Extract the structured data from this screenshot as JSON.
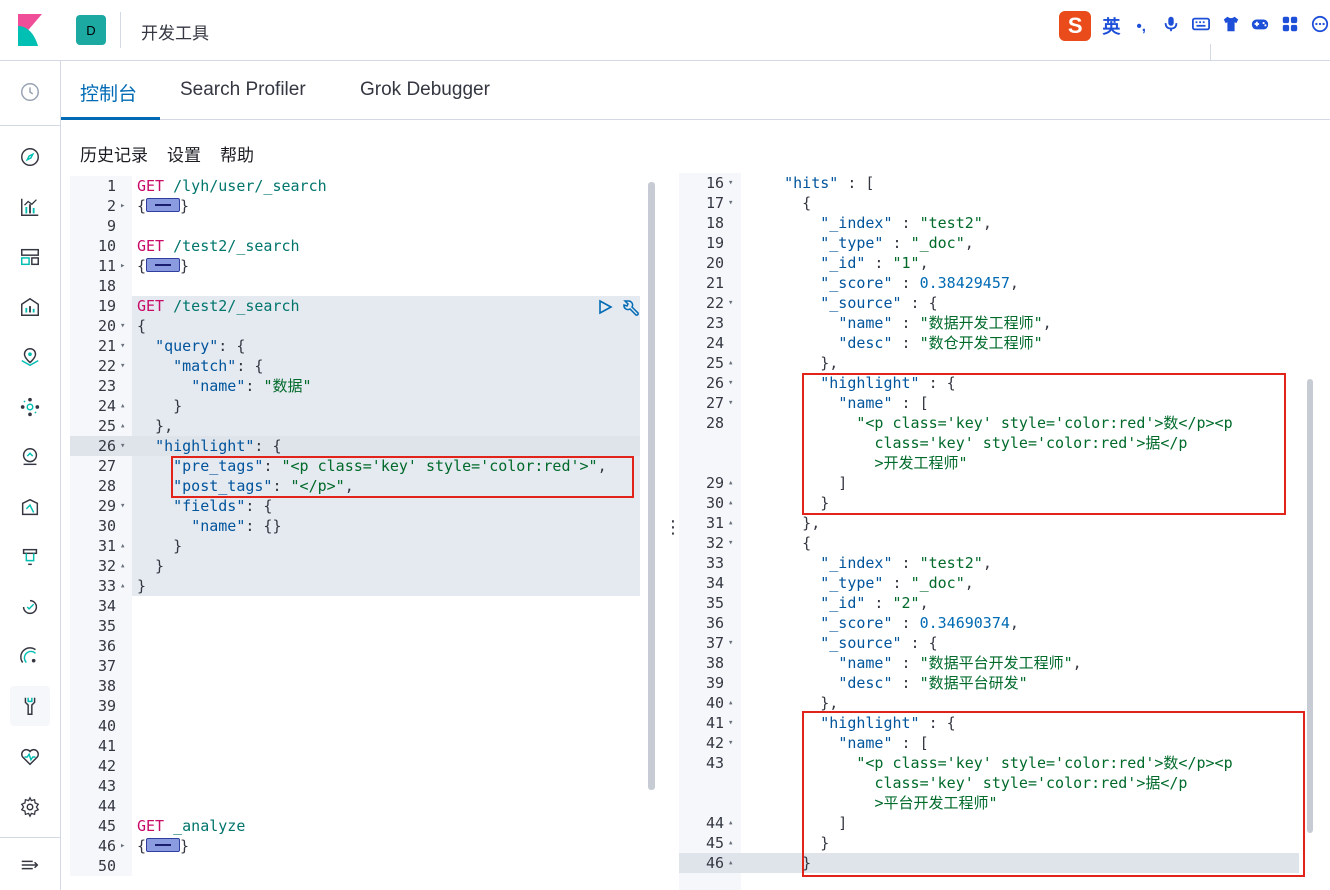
{
  "header": {
    "space_initial": "D",
    "app_title": "开发工具",
    "ime": {
      "logo": "S",
      "mode": "英",
      "punct": "•,",
      "icons": [
        "microphone-icon",
        "keyboard-icon",
        "shirt-icon",
        "gamepad-icon",
        "apps-grid-icon",
        "more-icon"
      ]
    }
  },
  "nav": {
    "icons": [
      "clock-icon",
      "compass-icon",
      "chart-icon",
      "dashboard-icon",
      "canvas-icon",
      "map-pin-icon",
      "ml-icon",
      "graph-icon",
      "apm-icon",
      "logs-icon",
      "uptime-icon",
      "siem-icon",
      "dev-tools-icon",
      "monitoring-icon",
      "gear-icon",
      "collapse-icon"
    ],
    "active": "dev-tools-icon"
  },
  "tabs": [
    {
      "label": "控制台",
      "active": true
    },
    {
      "label": "Search Profiler",
      "active": false
    },
    {
      "label": "Grok Debugger",
      "active": false
    }
  ],
  "submenu": [
    "历史记录",
    "设置",
    "帮助"
  ],
  "colors": {
    "accent": "#006bb4",
    "method": "#c80a68",
    "highlight_box": "#e2231a"
  },
  "request_editor": {
    "lines": [
      {
        "n": "1",
        "fold": "",
        "html": "<span class='k-m'>GET</span> <span class='k-p'>/lyh/user/_search</span>"
      },
      {
        "n": "2",
        "fold": "▸",
        "html": "{<span class='fold-chip'></span>}"
      },
      {
        "n": "9",
        "fold": "",
        "html": ""
      },
      {
        "n": "10",
        "fold": "",
        "html": "<span class='k-m'>GET</span> <span class='k-p'>/test2/_search</span>"
      },
      {
        "n": "11",
        "fold": "▸",
        "html": "{<span class='fold-chip'></span>}"
      },
      {
        "n": "18",
        "fold": "",
        "html": ""
      },
      {
        "n": "19",
        "fold": "",
        "html": "<span class='k-m'>GET</span> <span class='k-p'>/test2/_search</span>"
      },
      {
        "n": "20",
        "fold": "▾",
        "html": "{"
      },
      {
        "n": "21",
        "fold": "▾",
        "html": "  <span class='k-n'>\"query\"</span>: {"
      },
      {
        "n": "22",
        "fold": "▾",
        "html": "    <span class='k-n'>\"match\"</span>: {"
      },
      {
        "n": "23",
        "fold": "",
        "html": "      <span class='k-n'>\"name\"</span>: <span class='k-str'>\"数据\"</span>"
      },
      {
        "n": "24",
        "fold": "▴",
        "html": "    }"
      },
      {
        "n": "25",
        "fold": "▴",
        "html": "  },"
      },
      {
        "n": "26",
        "fold": "▾",
        "html": "  <span class='k-n'>\"highlight\"</span>: {"
      },
      {
        "n": "27",
        "fold": "",
        "html": "    <span class='k-n'>\"pre_tags\"</span>: <span class='k-str'>\"&lt;p class='key' style='color:red'&gt;\"</span>,"
      },
      {
        "n": "28",
        "fold": "",
        "html": "    <span class='k-n'>\"post_tags\"</span>: <span class='k-str'>\"&lt;/p&gt;\"</span>,"
      },
      {
        "n": "29",
        "fold": "▾",
        "html": "    <span class='k-n'>\"fields\"</span>: {"
      },
      {
        "n": "30",
        "fold": "",
        "html": "      <span class='k-n'>\"name\"</span>: {}"
      },
      {
        "n": "31",
        "fold": "▴",
        "html": "    }"
      },
      {
        "n": "32",
        "fold": "▴",
        "html": "  }"
      },
      {
        "n": "33",
        "fold": "▴",
        "html": "}"
      },
      {
        "n": "34",
        "fold": "",
        "html": ""
      },
      {
        "n": "35",
        "fold": "",
        "html": ""
      },
      {
        "n": "36",
        "fold": "",
        "html": ""
      },
      {
        "n": "37",
        "fold": "",
        "html": ""
      },
      {
        "n": "38",
        "fold": "",
        "html": ""
      },
      {
        "n": "39",
        "fold": "",
        "html": ""
      },
      {
        "n": "40",
        "fold": "",
        "html": ""
      },
      {
        "n": "41",
        "fold": "",
        "html": ""
      },
      {
        "n": "42",
        "fold": "",
        "html": ""
      },
      {
        "n": "43",
        "fold": "",
        "html": ""
      },
      {
        "n": "44",
        "fold": "",
        "html": ""
      },
      {
        "n": "45",
        "fold": "",
        "html": "<span class='k-m'>GET</span> <span class='k-p'>_analyze</span>"
      },
      {
        "n": "46",
        "fold": "▸",
        "html": "{<span class='fold-chip'></span>}"
      },
      {
        "n": "50",
        "fold": "",
        "html": ""
      }
    ]
  },
  "response_editor": {
    "lines": [
      {
        "n": "16",
        "fold": "▾",
        "html": "    <span class='k-n'>\"hits\"</span> : ["
      },
      {
        "n": "17",
        "fold": "▾",
        "html": "      {"
      },
      {
        "n": "18",
        "fold": "",
        "html": "        <span class='k-n'>\"_index\"</span> : <span class='k-str'>\"test2\"</span>,"
      },
      {
        "n": "19",
        "fold": "",
        "html": "        <span class='k-n'>\"_type\"</span> : <span class='k-str'>\"_doc\"</span>,"
      },
      {
        "n": "20",
        "fold": "",
        "html": "        <span class='k-n'>\"_id\"</span> : <span class='k-str'>\"1\"</span>,"
      },
      {
        "n": "21",
        "fold": "",
        "html": "        <span class='k-n'>\"_score\"</span> : <span class='k-num'>0.38429457</span>,"
      },
      {
        "n": "22",
        "fold": "▾",
        "html": "        <span class='k-n'>\"_source\"</span> : {"
      },
      {
        "n": "23",
        "fold": "",
        "html": "          <span class='k-n'>\"name\"</span> : <span class='k-str'>\"数据开发工程师\"</span>,"
      },
      {
        "n": "24",
        "fold": "",
        "html": "          <span class='k-n'>\"desc\"</span> : <span class='k-str'>\"数仓开发工程师\"</span>"
      },
      {
        "n": "25",
        "fold": "▴",
        "html": "        },"
      },
      {
        "n": "26",
        "fold": "▾",
        "html": "        <span class='k-n'>\"highlight\"</span> : {"
      },
      {
        "n": "27",
        "fold": "▾",
        "html": "          <span class='k-n'>\"name\"</span> : ["
      },
      {
        "n": "28",
        "fold": "",
        "html": "            <span class='k-str'>\"&lt;p class='key' style='color:red'&gt;数&lt;/p&gt;&lt;p</span>"
      },
      {
        "n": "",
        "fold": "",
        "html": "              <span class='k-str'>class='key' style='color:red'&gt;据&lt;/p</span>"
      },
      {
        "n": "",
        "fold": "",
        "html": "              <span class='k-str'>&gt;开发工程师\"</span>"
      },
      {
        "n": "29",
        "fold": "▴",
        "html": "          ]"
      },
      {
        "n": "30",
        "fold": "▴",
        "html": "        }"
      },
      {
        "n": "31",
        "fold": "▴",
        "html": "      },"
      },
      {
        "n": "32",
        "fold": "▾",
        "html": "      {"
      },
      {
        "n": "33",
        "fold": "",
        "html": "        <span class='k-n'>\"_index\"</span> : <span class='k-str'>\"test2\"</span>,"
      },
      {
        "n": "34",
        "fold": "",
        "html": "        <span class='k-n'>\"_type\"</span> : <span class='k-str'>\"_doc\"</span>,"
      },
      {
        "n": "35",
        "fold": "",
        "html": "        <span class='k-n'>\"_id\"</span> : <span class='k-str'>\"2\"</span>,"
      },
      {
        "n": "36",
        "fold": "",
        "html": "        <span class='k-n'>\"_score\"</span> : <span class='k-num'>0.34690374</span>,"
      },
      {
        "n": "37",
        "fold": "▾",
        "html": "        <span class='k-n'>\"_source\"</span> : {"
      },
      {
        "n": "38",
        "fold": "",
        "html": "          <span class='k-n'>\"name\"</span> : <span class='k-str'>\"数据平台开发工程师\"</span>,"
      },
      {
        "n": "39",
        "fold": "",
        "html": "          <span class='k-n'>\"desc\"</span> : <span class='k-str'>\"数据平台研发\"</span>"
      },
      {
        "n": "40",
        "fold": "▴",
        "html": "        },"
      },
      {
        "n": "41",
        "fold": "▾",
        "html": "        <span class='k-n'>\"highlight\"</span> : {"
      },
      {
        "n": "42",
        "fold": "▾",
        "html": "          <span class='k-n'>\"name\"</span> : ["
      },
      {
        "n": "43",
        "fold": "",
        "html": "            <span class='k-str'>\"&lt;p class='key' style='color:red'&gt;数&lt;/p&gt;&lt;p</span>"
      },
      {
        "n": "",
        "fold": "",
        "html": "              <span class='k-str'>class='key' style='color:red'&gt;据&lt;/p</span>"
      },
      {
        "n": "",
        "fold": "",
        "html": "              <span class='k-str'>&gt;平台开发工程师\"</span>"
      },
      {
        "n": "44",
        "fold": "▴",
        "html": "          ]"
      },
      {
        "n": "45",
        "fold": "▴",
        "html": "        }"
      },
      {
        "n": "46",
        "fold": "▴",
        "html": "      }"
      }
    ]
  }
}
